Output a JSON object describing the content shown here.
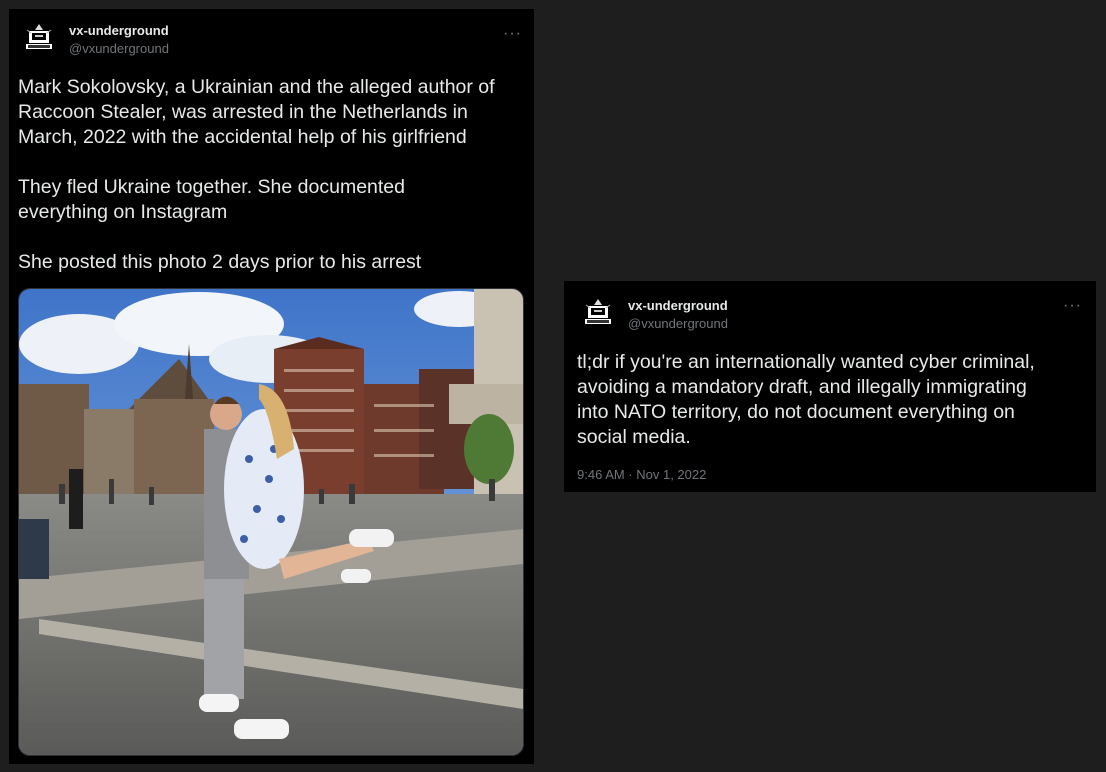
{
  "tweet1": {
    "display_name": "vx-underground",
    "handle": "@vxunderground",
    "more_label": "···",
    "text": "Mark Sokolovsky, a Ukrainian and the alleged author of\nRaccoon Stealer, was arrested in the Netherlands in\nMarch, 2022 with the accidental help of his girlfriend\n\nThey fled Ukraine together. She documented\neverything on Instagram\n\nShe posted this photo 2 days prior to his arrest",
    "photo_icon": "couple-photo-dam-square"
  },
  "tweet2": {
    "display_name": "vx-underground",
    "handle": "@vxunderground",
    "more_label": "···",
    "text": "tl;dr if you're an internationally wanted cyber criminal,\navoiding a mandatory draft, and illegally immigrating\ninto NATO territory, do not document everything on\nsocial media.",
    "timestamp": "9:46 AM · Nov 1, 2022"
  },
  "colors": {
    "page_bg": "#1e1e1e",
    "card_bg": "#000000",
    "text_primary": "#e7e9ea",
    "text_secondary": "#71767b"
  },
  "icons": {
    "avatar": "vx-underground-logo-icon",
    "more": "more-dots-icon"
  }
}
